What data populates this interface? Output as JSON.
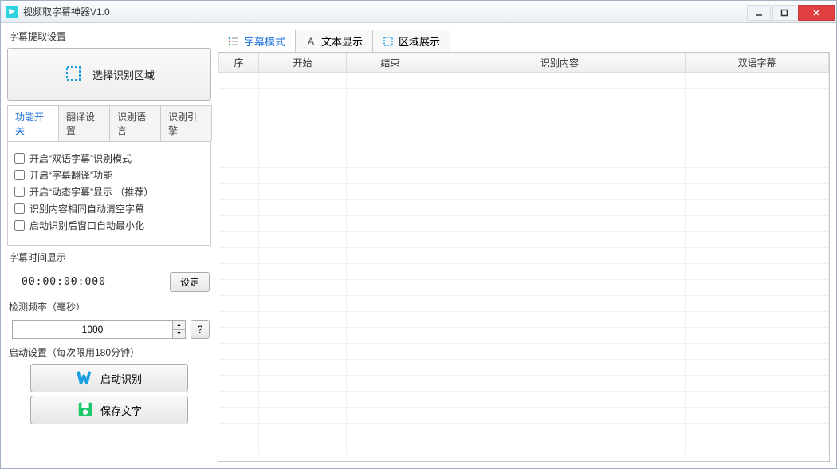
{
  "window": {
    "title": "视频取字幕神器V1.0"
  },
  "left": {
    "section_extract_title": "字幕提取设置",
    "select_region_label": "选择识别区域",
    "tabs": [
      {
        "label": "功能开关"
      },
      {
        "label": "翻译设置"
      },
      {
        "label": "识别语言"
      },
      {
        "label": "识别引擎"
      }
    ],
    "checks": [
      "开启“双语字幕”识别模式",
      "开启“字幕翻译”功能",
      "开启“动态字幕”显示   （推荐）",
      "识别内容相同自动清空字幕",
      "启动识别后窗口自动最小化"
    ],
    "time_section_title": "字幕时间显示",
    "time_value": "00:00:00:000",
    "time_set_label": "设定",
    "freq_section_title": "检测频率（毫秒）",
    "freq_value": "1000",
    "help_label": "?",
    "launch_section_title": "启动设置（每次限用180分钟）",
    "launch_label": "启动识别",
    "save_label": "保存文字"
  },
  "right": {
    "tabs": [
      {
        "label": "字幕模式",
        "icon": "list-icon"
      },
      {
        "label": "文本显示",
        "icon": "font-icon"
      },
      {
        "label": "区域展示",
        "icon": "crop-icon"
      }
    ],
    "columns": [
      "序",
      "开始",
      "结束",
      "识别内容",
      "双语字幕"
    ],
    "col_widths": [
      "50px",
      "110px",
      "110px",
      "auto",
      "180px"
    ],
    "rows": []
  }
}
